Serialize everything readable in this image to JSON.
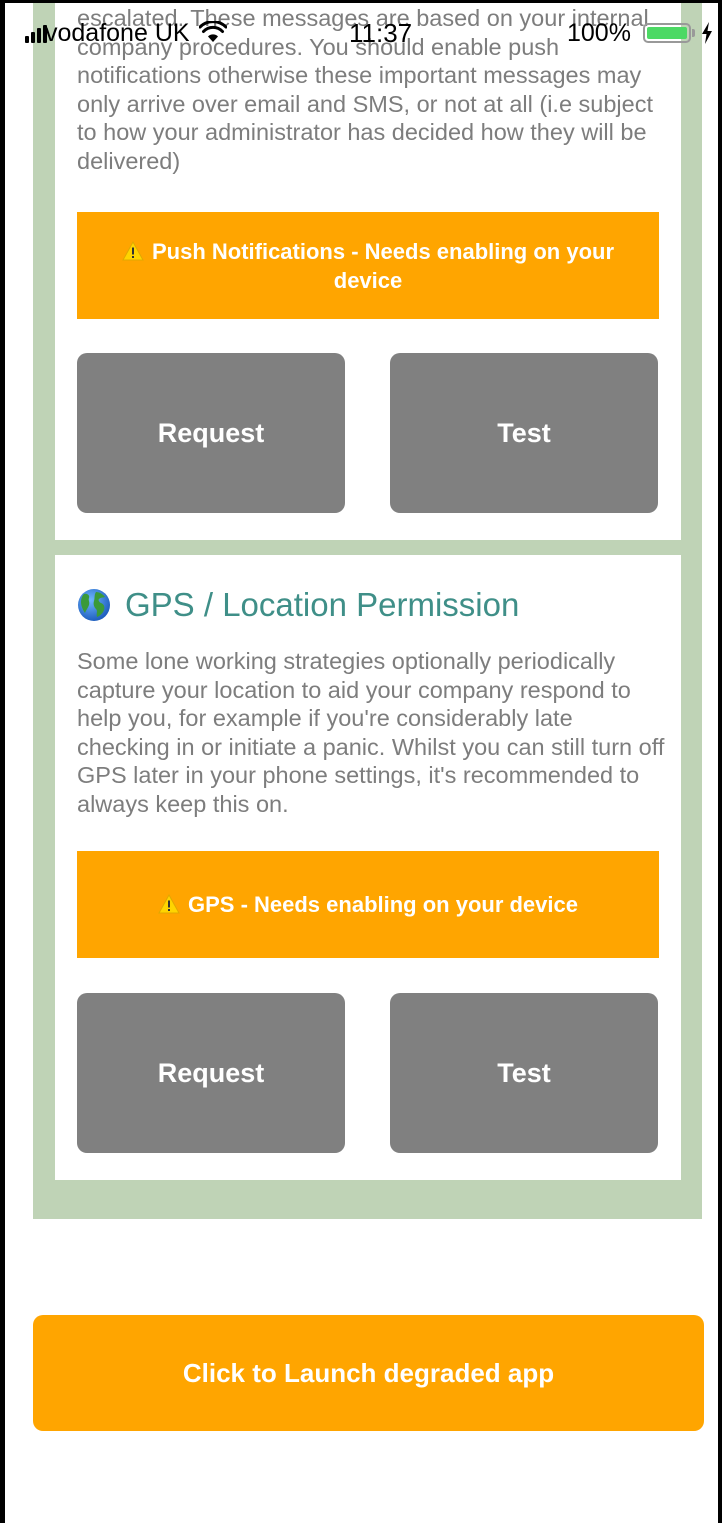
{
  "status_bar": {
    "carrier": "vodafone UK",
    "time": "11:37",
    "battery_percent_label": "100%",
    "battery_level": 1.0,
    "signal_icon": "signal-bars-icon",
    "wifi_icon": "wifi-icon",
    "charging_icon": "lightning-bolt-icon"
  },
  "push_section": {
    "description": "escalated.  These messages are based on your internal company procedures. You should enable push notifications otherwise these important messages may only arrive over email and SMS, or not at all (i.e subject to how your administrator has decided how they will be delivered)",
    "warning_icon": "warning-icon",
    "warning_text": "Push Notifications - Needs enabling on your device",
    "request_label": "Request",
    "test_label": "Test"
  },
  "gps_section": {
    "title_icon": "globe-icon",
    "title": "GPS / Location Permission",
    "description": "Some lone working strategies optionally periodically capture your location to aid your company respond to help you, for example if you're considerably late checking in or initiate a panic. Whilst you can still turn off GPS later in your phone settings, it's recommended to always keep this on.",
    "warning_icon": "warning-icon",
    "warning_text": "GPS - Needs enabling on your device",
    "request_label": "Request",
    "test_label": "Test"
  },
  "launch_button_label": "Click to Launch degraded app",
  "colors": {
    "panel_green": "#bfd3b6",
    "warning_orange": "#ffa500",
    "button_gray": "#808080",
    "title_teal": "#3f8f88",
    "body_text_gray": "#7d7d7d",
    "battery_green": "#4cd964"
  }
}
